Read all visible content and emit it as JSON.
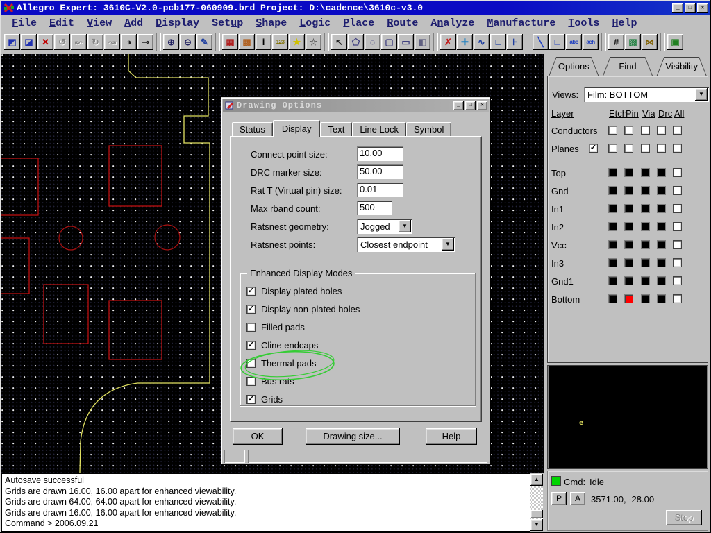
{
  "window": {
    "title": "Allegro Expert: 3610C-V2.0-pcb177-060909.brd  Project: D:\\cadence\\3610c-v3.0",
    "buttons": [
      "minimize",
      "restore",
      "close"
    ],
    "button_glyphs": [
      "_",
      "❐",
      "✕"
    ]
  },
  "menu": {
    "items": [
      {
        "label": "File",
        "accel": 0
      },
      {
        "label": "Edit",
        "accel": 0
      },
      {
        "label": "View",
        "accel": 0
      },
      {
        "label": "Add",
        "accel": 0
      },
      {
        "label": "Display",
        "accel": 0
      },
      {
        "label": "Setup",
        "accel": 3
      },
      {
        "label": "Shape",
        "accel": 0
      },
      {
        "label": "Logic",
        "accel": 0
      },
      {
        "label": "Place",
        "accel": 0
      },
      {
        "label": "Route",
        "accel": 0
      },
      {
        "label": "Analyze",
        "accel": 1
      },
      {
        "label": "Manufacture",
        "accel": 0
      },
      {
        "label": "Tools",
        "accel": 0
      },
      {
        "label": "Help",
        "accel": 0
      }
    ]
  },
  "toolbar": {
    "groups": [
      {
        "buttons": [
          {
            "name": "unrats-components",
            "glyph": "◩",
            "color": "#2030b0",
            "enabled": true
          },
          {
            "name": "rats-components",
            "glyph": "◪",
            "color": "#2030b0",
            "enabled": true
          },
          {
            "name": "delete",
            "glyph": "✕",
            "color": "#c00000",
            "enabled": true
          },
          {
            "name": "undo",
            "glyph": "↺",
            "color": "#404040",
            "enabled": false
          },
          {
            "name": "cancel",
            "glyph": "↜",
            "color": "#404040",
            "enabled": false
          },
          {
            "name": "redo",
            "glyph": "↻",
            "color": "#404040",
            "enabled": false
          },
          {
            "name": "done",
            "glyph": "↝",
            "color": "#404040",
            "enabled": false
          },
          {
            "name": "mirror",
            "glyph": "◑",
            "color": "#202020",
            "enabled": true
          },
          {
            "name": "fix-pin",
            "glyph": "⊸",
            "color": "#202020",
            "enabled": true
          }
        ]
      },
      {
        "buttons": [
          {
            "name": "zoom-in",
            "glyph": "⊕",
            "color": "#202060",
            "enabled": true
          },
          {
            "name": "zoom-out",
            "glyph": "⊖",
            "color": "#202060",
            "enabled": true
          },
          {
            "name": "redraw",
            "glyph": "✎",
            "color": "#2040a0",
            "enabled": true
          }
        ]
      },
      {
        "buttons": [
          {
            "name": "color192",
            "glyph": "▦",
            "color": "#b02020",
            "enabled": true
          },
          {
            "name": "color-priority",
            "glyph": "▩",
            "color": "#b06020",
            "enabled": true
          },
          {
            "name": "show-element-info",
            "glyph": "i",
            "color": "#000000",
            "enabled": true
          },
          {
            "name": "measure-123",
            "glyph": "123",
            "color": "#807000",
            "enabled": true,
            "small": true
          },
          {
            "name": "highlight",
            "glyph": "★",
            "color": "#d0c000",
            "enabled": true
          },
          {
            "name": "dehighlight",
            "glyph": "☆",
            "color": "#606060",
            "enabled": true
          }
        ]
      },
      {
        "buttons": [
          {
            "name": "select-cursor",
            "glyph": "↖",
            "color": "#202020",
            "enabled": true
          },
          {
            "name": "shape-polygon",
            "glyph": "⬠",
            "color": "#404080",
            "enabled": true
          },
          {
            "name": "shape-circular",
            "glyph": "◌",
            "color": "#404080",
            "enabled": true
          },
          {
            "name": "shape-rectangular",
            "glyph": "▢",
            "color": "#404080",
            "enabled": true
          },
          {
            "name": "shape-void",
            "glyph": "▭",
            "color": "#404080",
            "enabled": true
          },
          {
            "name": "shape-shade",
            "glyph": "◧",
            "color": "#606080",
            "enabled": true
          }
        ]
      },
      {
        "buttons": [
          {
            "name": "delete-vertex",
            "glyph": "✗",
            "color": "#c02020",
            "enabled": true
          },
          {
            "name": "add-vertex",
            "glyph": "✛",
            "color": "#2080c0",
            "enabled": true
          },
          {
            "name": "slide",
            "glyph": "∿",
            "color": "#2040a0",
            "enabled": true
          },
          {
            "name": "create-detour",
            "glyph": "∟",
            "color": "#2040a0",
            "enabled": true
          },
          {
            "name": "vertex-edit",
            "glyph": "⊦",
            "color": "#2040a0",
            "enabled": true
          }
        ]
      },
      {
        "buttons": [
          {
            "name": "add-line",
            "glyph": "╲",
            "color": "#2040c0",
            "enabled": true
          },
          {
            "name": "add-rectangle",
            "glyph": "□",
            "color": "#2040c0",
            "enabled": true
          },
          {
            "name": "add-text",
            "glyph": "abc",
            "color": "#2040c0",
            "enabled": true,
            "small": true
          },
          {
            "name": "text-edit",
            "glyph": "ach",
            "color": "#2040c0",
            "enabled": true,
            "small": true
          }
        ]
      },
      {
        "buttons": [
          {
            "name": "define-grid",
            "glyph": "#",
            "color": "#202020",
            "enabled": true
          },
          {
            "name": "color-dialog",
            "glyph": "▧",
            "color": "#208040",
            "enabled": true
          },
          {
            "name": "constraints",
            "glyph": "⋈",
            "color": "#806000",
            "enabled": true
          }
        ]
      },
      {
        "buttons": [
          {
            "name": "drc-status",
            "glyph": "▣",
            "color": "#208020",
            "enabled": true
          }
        ]
      }
    ]
  },
  "dialog": {
    "title": "Drawing Options",
    "window_buttons": [
      "minimize",
      "maximize",
      "close"
    ],
    "window_button_glyphs": [
      "_",
      "□",
      "✕"
    ],
    "tabs": [
      "Status",
      "Display",
      "Text",
      "Line Lock",
      "Symbol"
    ],
    "active_tab": "Display",
    "fields": [
      {
        "label": "Connect point size:",
        "value": "10.00",
        "type": "text"
      },
      {
        "label": "DRC marker size:",
        "value": "50.00",
        "type": "text"
      },
      {
        "label": "Rat T (Virtual pin) size:",
        "value": "0.01",
        "type": "text"
      },
      {
        "label": "Max rband count:",
        "value": "500",
        "type": "text"
      },
      {
        "label": "Ratsnest geometry:",
        "value": "Jogged",
        "type": "select"
      },
      {
        "label": "Ratsnest points:",
        "value": "Closest endpoint",
        "type": "select"
      }
    ],
    "group_title": "Enhanced Display Modes",
    "checkboxes": [
      {
        "label": "Display plated holes",
        "checked": true
      },
      {
        "label": "Display non-plated holes",
        "checked": true
      },
      {
        "label": "Filled pads",
        "checked": false,
        "annotated": true
      },
      {
        "label": "Cline endcaps",
        "checked": true
      },
      {
        "label": "Thermal pads",
        "checked": false
      },
      {
        "label": "Bus rats",
        "checked": false
      },
      {
        "label": "Grids",
        "checked": true
      }
    ],
    "buttons": {
      "ok": "OK",
      "drawing_size": "Drawing size...",
      "help": "Help"
    },
    "annotation_color": "#35cc35"
  },
  "panel": {
    "tabs": [
      "Options",
      "Find",
      "Visibility"
    ],
    "active_tab": "Visibility",
    "views_label": "Views:",
    "views_value": "Film: BOTTOM",
    "layer_header": "Layer",
    "columns": [
      "Etch",
      "Pin",
      "Via",
      "Drc",
      "All"
    ],
    "static_rows": [
      {
        "label": "Conductors",
        "label_checkbox": null
      },
      {
        "label": "Planes",
        "label_checkbox": true
      }
    ],
    "layers": [
      {
        "name": "Top",
        "colors": [
          "#000000",
          "#000000",
          "#000000",
          "#000000"
        ],
        "all_checked": false
      },
      {
        "name": "Gnd",
        "colors": [
          "#000000",
          "#000000",
          "#000000",
          "#000000"
        ],
        "all_checked": false
      },
      {
        "name": "In1",
        "colors": [
          "#000000",
          "#000000",
          "#000000",
          "#000000"
        ],
        "all_checked": false
      },
      {
        "name": "In2",
        "colors": [
          "#000000",
          "#000000",
          "#000000",
          "#000000"
        ],
        "all_checked": false
      },
      {
        "name": "Vcc",
        "colors": [
          "#000000",
          "#000000",
          "#000000",
          "#000000"
        ],
        "all_checked": false
      },
      {
        "name": "In3",
        "colors": [
          "#000000",
          "#000000",
          "#000000",
          "#000000"
        ],
        "all_checked": false
      },
      {
        "name": "Gnd1",
        "colors": [
          "#000000",
          "#000000",
          "#000000",
          "#000000"
        ],
        "all_checked": false
      },
      {
        "name": "Bottom",
        "colors": [
          "#000000",
          "#ff0000",
          "#000000",
          "#000000"
        ],
        "all_checked": false
      }
    ]
  },
  "world_view": {
    "marker_glyph": "e",
    "marker_color": "#d2d25a"
  },
  "command": {
    "label": "Cmd:",
    "status": "Idle",
    "p_button": "P",
    "a_button": "A",
    "coords": "3571.00, -28.00",
    "stop_button": "Stop",
    "indicator_color": "#00d400"
  },
  "console": {
    "lines": [
      "Autosave successful",
      "Grids are drawn 16.00, 16.00 apart for enhanced viewability.",
      "Grids are drawn 64.00, 64.00 apart for enhanced viewability.",
      "Grids are drawn 16.00, 16.00 apart for enhanced viewability.",
      "Command > 2006.09.21"
    ]
  },
  "colors": {
    "titlebar": "#0a0ac4",
    "board_outline": "#e0e060",
    "pcb_shape_red": "#cc1010",
    "bottom_pin_swatch": "#ff0000"
  }
}
